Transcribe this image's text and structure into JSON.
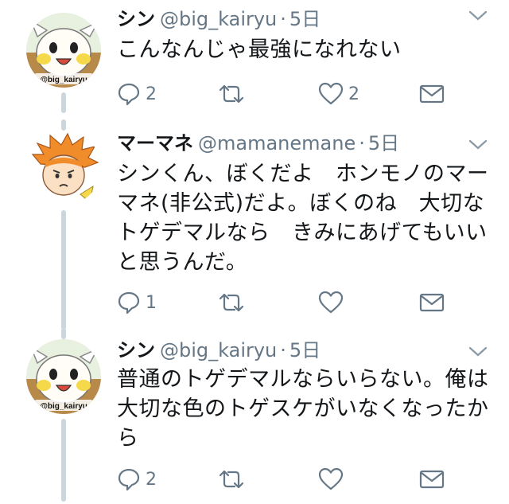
{
  "tweets": [
    {
      "name": "シン",
      "handle": "@big_kairyu",
      "time": "5日",
      "text": "こんなんじゃ最強になれない",
      "avatar_label": "@big_kairyu",
      "reply_count": "2",
      "retweet_count": "",
      "like_count": "2"
    },
    {
      "name": "マーマネ",
      "handle": "@mamanemane",
      "time": "5日",
      "text": "シンくん、ぼくだよ　ホンモノのマーマネ(非公式)だよ。ぼくのね　大切なトゲデマルなら　きみにあげてもいいと思うんだ。",
      "avatar_label": "",
      "reply_count": "1",
      "retweet_count": "",
      "like_count": ""
    },
    {
      "name": "シン",
      "handle": "@big_kairyu",
      "time": "5日",
      "text": "普通のトゲデマルならいらない。俺は大切な色のトゲスケがいなくなったから",
      "avatar_label": "@big_kairyu",
      "reply_count": "2",
      "retweet_count": "",
      "like_count": ""
    }
  ],
  "separator": "·",
  "colors": {
    "text": "#14171a",
    "secondary": "#657786",
    "thread_line": "#ccd6dd",
    "icon": "#657786"
  }
}
